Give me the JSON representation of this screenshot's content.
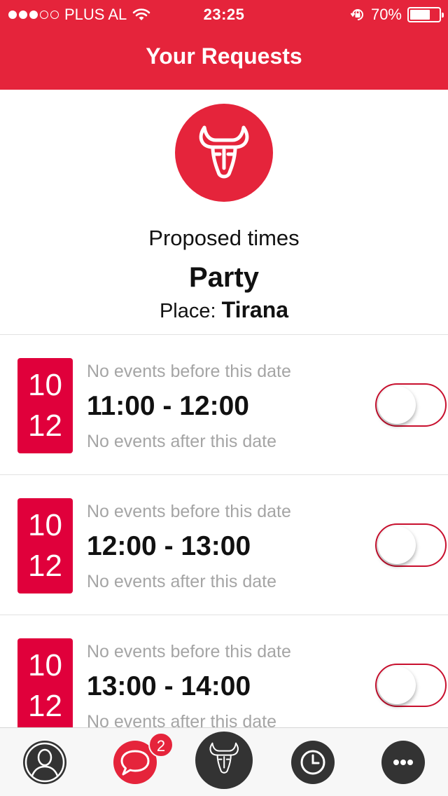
{
  "status_bar": {
    "carrier": "PLUS AL",
    "time": "23:25",
    "battery_percent": "70%",
    "battery_level": 0.7
  },
  "nav": {
    "title": "Your Requests"
  },
  "hero": {
    "logo_icon": "bull-head-icon",
    "subtitle": "Proposed times",
    "event_name": "Party",
    "place_label": "Place:",
    "place_value": "Tirana"
  },
  "slots": [
    {
      "day": "10",
      "month": "12",
      "before": "No events before this date",
      "time": "11:00 - 12:00",
      "after": "No events after this date",
      "selected": false
    },
    {
      "day": "10",
      "month": "12",
      "before": "No events before this date",
      "time": "12:00 - 13:00",
      "after": "No events after this date",
      "selected": false
    },
    {
      "day": "10",
      "month": "12",
      "before": "No events before this date",
      "time": "13:00 - 14:00",
      "after": "No events after this date",
      "selected": false
    }
  ],
  "tabbar": {
    "items": [
      "profile-icon",
      "chat-icon",
      "bull-head-icon",
      "clock-icon",
      "more-icon"
    ],
    "chat_badge": "2"
  },
  "colors": {
    "accent": "#e5243b",
    "date_badge": "#e0003b",
    "muted_text": "#a5a5a5",
    "tab_icon": "#333333"
  }
}
